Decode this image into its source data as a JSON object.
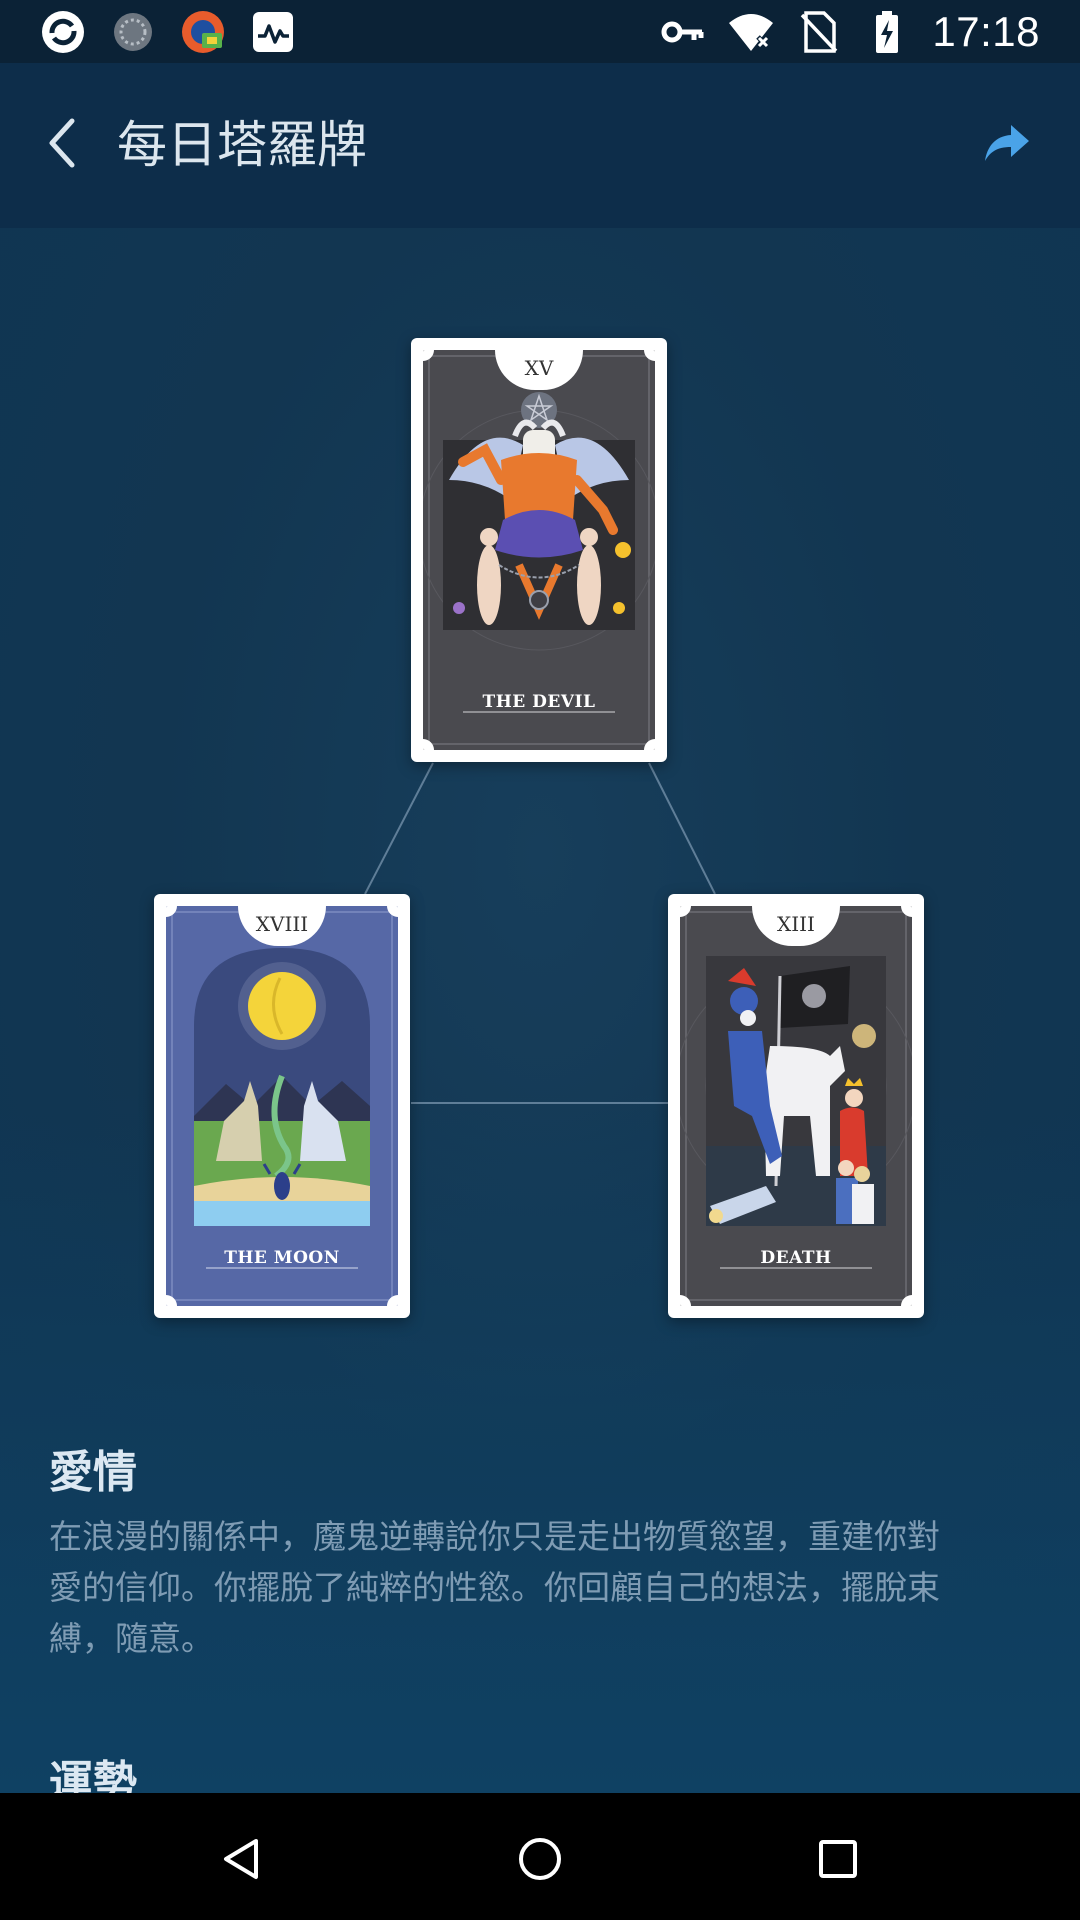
{
  "status_bar": {
    "time": "17:18",
    "left_icons": [
      "app-refresh-icon",
      "loading-circle-icon",
      "app-badge-icon",
      "activity-monitor-icon"
    ],
    "right_icons": [
      "vpn-key-icon",
      "wifi-off-icon",
      "no-sim-icon",
      "battery-charging-icon"
    ]
  },
  "app_bar": {
    "title": "每日塔羅牌",
    "back_icon": "chevron-left-icon",
    "share_icon": "share-arrow-icon"
  },
  "cards": [
    {
      "numeral": "XV",
      "name": "THE DEVIL",
      "theme": "#4a4a4f"
    },
    {
      "numeral": "XVIII",
      "name": "THE MOON",
      "theme": "#5668a6"
    },
    {
      "numeral": "XIII",
      "name": "DEATH",
      "theme": "#4a4a4f"
    }
  ],
  "sections": [
    {
      "title": "愛情",
      "lines": [
        "在浪漫的關係中，魔鬼逆轉說你只是走出物質慾望，重建你對",
        "愛的信仰。你擺脫了純粹的性慾。你回顧自己的想法，擺脫束",
        "縛，隨意。"
      ]
    },
    {
      "title": "運勢"
    }
  ],
  "nav_bar": {
    "back_icon": "triangle-back-icon",
    "home_icon": "circle-home-icon",
    "recents_icon": "square-recents-icon"
  },
  "colors": {
    "status_bar": "#0b2236",
    "app_bar": "#0d2d4a",
    "background": "#123651",
    "accent_share": "#4aa3e8",
    "section_title": "#dce8f2",
    "section_text": "#7f9cb4"
  }
}
